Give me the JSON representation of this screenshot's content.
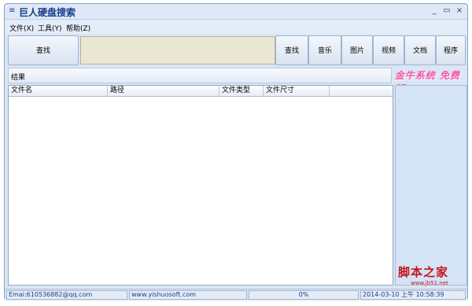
{
  "window": {
    "sysmenu_glyph": "≡",
    "title": "巨人硬盘搜索",
    "minimize": "_",
    "maximize": "▭",
    "close": "×"
  },
  "menu": [
    {
      "label": "文件(X)"
    },
    {
      "label": "工具(Y)"
    },
    {
      "label": "帮助(Z)"
    }
  ],
  "toolbar": {
    "search_button": "查找",
    "search_value": "",
    "buttons": [
      "查找",
      "音乐",
      "图片",
      "视频",
      "文档",
      "程序"
    ]
  },
  "results": {
    "label": "结果",
    "columns": [
      "文件名",
      "路径",
      "文件类型",
      "文件尺寸"
    ]
  },
  "ad": {
    "text": "金牛系统 免费版"
  },
  "watermark": {
    "title": "脚本之家",
    "url": "www.jb51.net"
  },
  "status": {
    "email": "Emai:610536882@qq.com",
    "site": "www.yishuosoft.com",
    "progress": "0%",
    "datetime": "2014-03-10 上午 10:58:39"
  }
}
